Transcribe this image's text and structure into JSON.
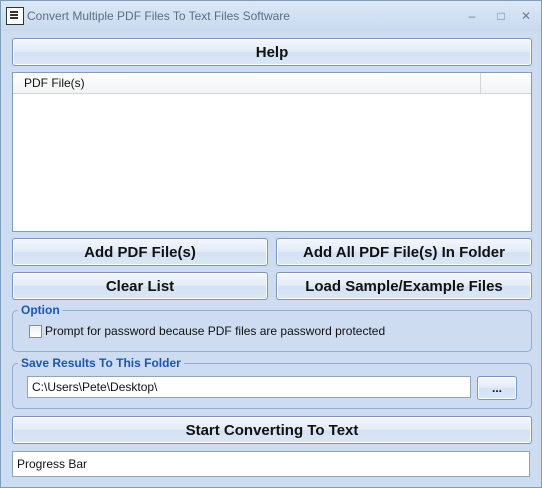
{
  "window": {
    "title": "Convert Multiple PDF Files To Text Files Software",
    "minimize_glyph": "–",
    "maximize_glyph": "□",
    "close_glyph": "✕"
  },
  "buttons": {
    "help": "Help",
    "add_pdf": "Add PDF File(s)",
    "add_all_pdf": "Add All PDF File(s) In Folder",
    "clear_list": "Clear List",
    "load_sample": "Load Sample/Example Files",
    "browse": "...",
    "start": "Start Converting To Text"
  },
  "file_list": {
    "column_header": "PDF File(s)",
    "rows": []
  },
  "option_group": {
    "legend": "Option",
    "password_checkbox_label": "Prompt for password because PDF files are password protected",
    "password_checked": false
  },
  "save_group": {
    "legend": "Save Results To This Folder",
    "folder_value": "C:\\Users\\Pete\\Desktop\\"
  },
  "progress": {
    "label": "Progress Bar"
  },
  "icons": {
    "app": "app-icon"
  }
}
